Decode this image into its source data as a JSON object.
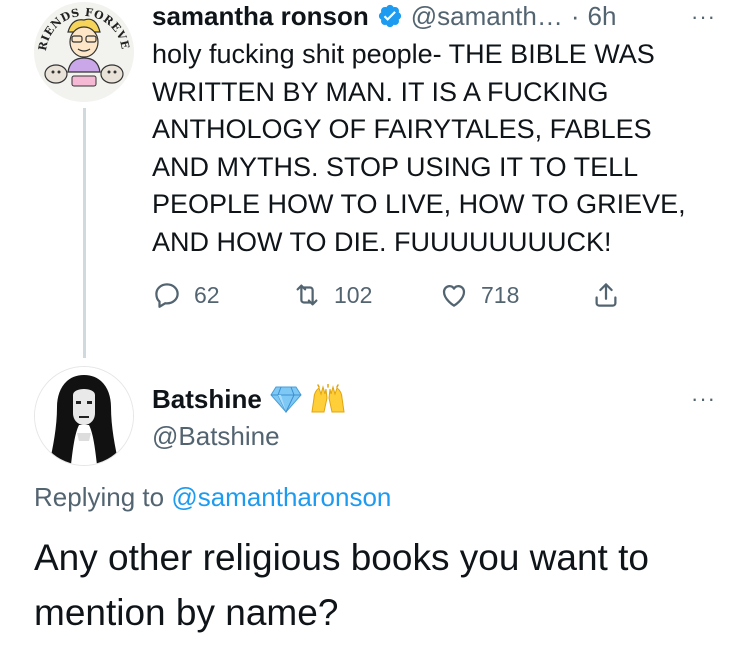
{
  "tweet": {
    "author_name": "samantha ronson",
    "author_handle": "@samanth…",
    "separator": "·",
    "time": "6h",
    "more_label": "···",
    "text": "holy fucking shit people- THE BIBLE WAS\nWRITTEN BY MAN. IT IS A FUCKING\nANTHOLOGY OF FAIRYTALES, FABLES\nAND MYTHS. STOP USING IT TO TELL\nPEOPLE HOW TO LIVE, HOW TO GRIEVE,\nAND HOW TO DIE. FUUUUUUUUCK!",
    "avatar_text_top": "FRIENDS FOREVER",
    "actions": {
      "reply_count": "62",
      "retweet_count": "102",
      "like_count": "718"
    },
    "icons": [
      "reply-icon",
      "retweet-icon",
      "like-icon",
      "share-icon",
      "verified-badge-icon"
    ]
  },
  "reply": {
    "author_name": "Batshine",
    "author_handle": "@Batshine",
    "emojis": [
      "gem-emoji",
      "raised-hands-emoji"
    ],
    "more_label": "···",
    "replying_prefix": "Replying to ",
    "replying_mention": "@samantharonson",
    "text": "Any other religious books you want to mention by name?"
  },
  "colors": {
    "text": "#0f1419",
    "secondary": "#536471",
    "link": "#1d9bf0",
    "verified": "#1d9bf0",
    "thread_line": "#cfd9de"
  }
}
